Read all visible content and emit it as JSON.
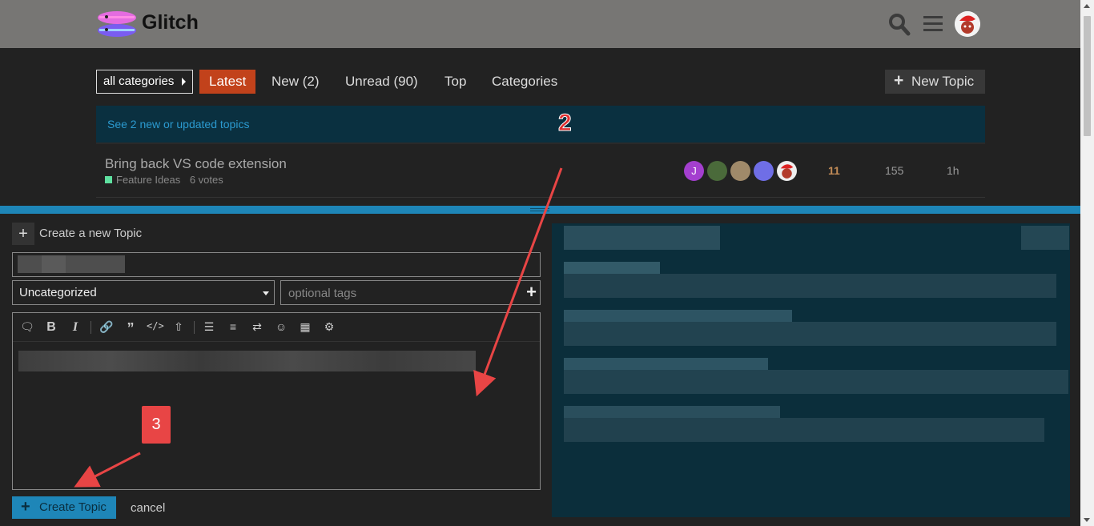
{
  "header": {
    "app_name": "Glitch",
    "icons": [
      "search-icon",
      "hamburger-menu-icon",
      "user-avatar"
    ]
  },
  "nav": {
    "category_dropdown": "all categories",
    "tabs": [
      "Latest",
      "New (2)",
      "Unread (90)",
      "Top",
      "Categories"
    ],
    "active_tab": "Latest",
    "new_topic_label": "New Topic"
  },
  "banner": {
    "text": "See 2 new or updated topics"
  },
  "topic": {
    "title": "Bring back VS code extension",
    "category": "Feature Ideas",
    "votes": "6 votes",
    "replies": "11",
    "views": "155",
    "activity": "1h",
    "first_avatar_letter": "J"
  },
  "composer": {
    "header_label": "Create a new Topic",
    "category_value": "Uncategorized",
    "tags_placeholder": "optional tags",
    "create_label": "Create Topic",
    "cancel_label": "cancel",
    "toolbar_icons": [
      "speech-bubble-icon",
      "bold-icon",
      "italic-icon",
      "link-icon",
      "quote-icon",
      "code-icon",
      "upload-icon",
      "bullet-list-icon",
      "numbered-list-icon",
      "swap-icon",
      "emoji-icon",
      "calendar-icon",
      "gear-icon"
    ]
  },
  "annotations": {
    "step2": "2",
    "step3": "3"
  },
  "colors": {
    "accent": "#c2421b",
    "composer_bar": "#1e86b8",
    "banner_bg": "#0a3040",
    "annotation": "#e84545"
  }
}
